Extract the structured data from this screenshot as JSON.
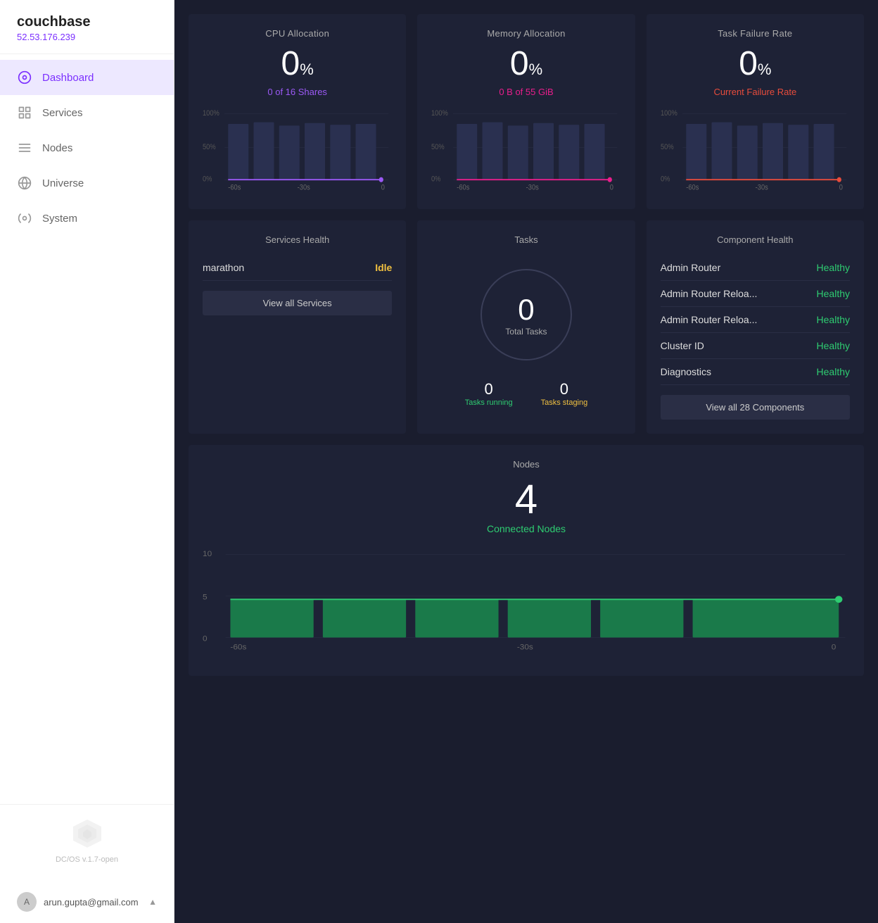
{
  "brand": {
    "name": "couchbase",
    "ip": "52.53.176.239"
  },
  "nav": {
    "items": [
      {
        "id": "dashboard",
        "label": "Dashboard",
        "active": true
      },
      {
        "id": "services",
        "label": "Services",
        "active": false
      },
      {
        "id": "nodes",
        "label": "Nodes",
        "active": false
      },
      {
        "id": "universe",
        "label": "Universe",
        "active": false
      },
      {
        "id": "system",
        "label": "System",
        "active": false
      }
    ]
  },
  "footer": {
    "version": "DC/OS v.1.7-open",
    "user_email": "arun.gupta@gmail.com"
  },
  "metrics": {
    "cpu": {
      "title": "CPU Allocation",
      "value": "0",
      "percent_symbol": "%",
      "subtitle": "0 of 16 Shares",
      "subtitle_color": "purple"
    },
    "memory": {
      "title": "Memory Allocation",
      "value": "0",
      "percent_symbol": "%",
      "subtitle": "0 B of 55 GiB",
      "subtitle_color": "pink"
    },
    "task_failure": {
      "title": "Task Failure Rate",
      "value": "0",
      "percent_symbol": "%",
      "subtitle": "Current Failure Rate",
      "subtitle_color": "red"
    }
  },
  "services_health": {
    "title": "Services Health",
    "items": [
      {
        "name": "marathon",
        "status": "Idle",
        "status_color": "idle"
      }
    ],
    "view_all_label": "View all Services"
  },
  "tasks": {
    "title": "Tasks",
    "total": "0",
    "total_label": "Total Tasks",
    "running": "0",
    "running_label": "Tasks running",
    "staging": "0",
    "staging_label": "Tasks staging"
  },
  "component_health": {
    "title": "Component Health",
    "items": [
      {
        "name": "Admin Router",
        "status": "Healthy"
      },
      {
        "name": "Admin Router Reloa...",
        "status": "Healthy"
      },
      {
        "name": "Admin Router Reloa...",
        "status": "Healthy"
      },
      {
        "name": "Cluster ID",
        "status": "Healthy"
      },
      {
        "name": "Diagnostics",
        "status": "Healthy"
      }
    ],
    "view_all_label": "View all 28 Components"
  },
  "nodes": {
    "title": "Nodes",
    "value": "4",
    "subtitle": "Connected Nodes"
  },
  "chart_labels": {
    "pct_100": "100%",
    "pct_50": "50%",
    "pct_0": "0%",
    "time_neg60": "-60s",
    "time_neg30": "-30s",
    "time_0": "0",
    "nodes_10": "10",
    "nodes_5": "5",
    "nodes_0": "0"
  }
}
